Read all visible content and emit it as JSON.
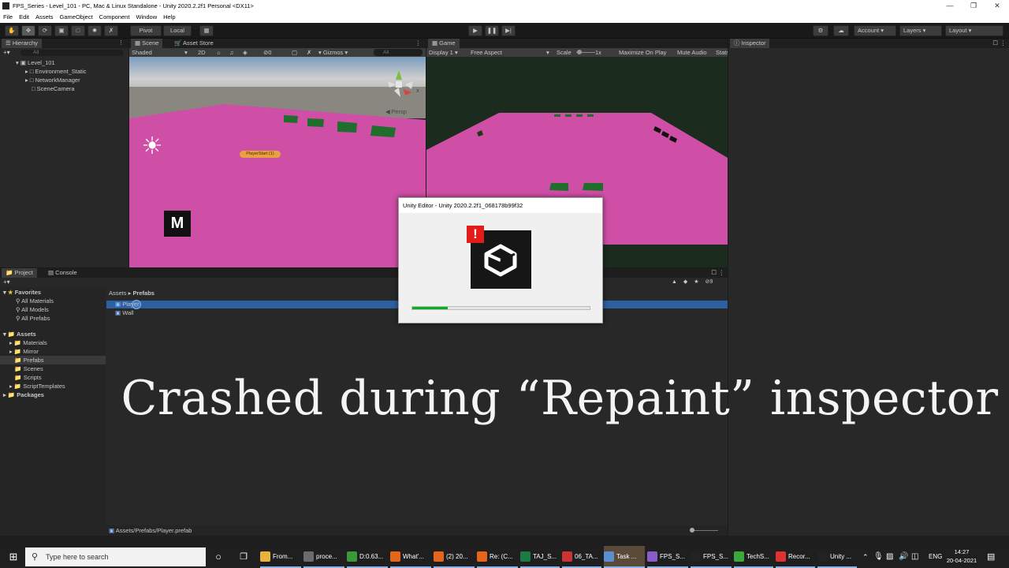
{
  "window": {
    "title": "FPS_Series - Level_101 - PC, Mac & Linux Standalone - Unity 2020.2.2f1 Personal <DX11>"
  },
  "menu": [
    "File",
    "Edit",
    "Assets",
    "GameObject",
    "Component",
    "Window",
    "Help"
  ],
  "toolbar": {
    "pivot": "Pivot",
    "local": "Local",
    "account": "Account",
    "layers": "Layers",
    "layout": "Layout"
  },
  "hierarchy": {
    "tab": "Hierarchy",
    "search_placeholder": "All",
    "root": "Level_101",
    "items": [
      "Environment_Static",
      "NetworkManager",
      "SceneCamera"
    ]
  },
  "scene": {
    "tab_scene": "Scene",
    "tab_asset_store": "Asset Store",
    "shading": "Shaded",
    "mode_2d": "2D",
    "fx_count": "0",
    "gizmos": "Gizmos",
    "search_placeholder": "All",
    "persp": "Persp",
    "player_start": "PlayerStart (1)",
    "overlay_glyph": "M"
  },
  "game": {
    "tab": "Game",
    "display": "Display 1",
    "aspect": "Free Aspect",
    "scale_label": "Scale",
    "scale_value": "1x",
    "maximize": "Maximize On Play",
    "mute": "Mute Audio",
    "stats": "Stats"
  },
  "inspector": {
    "tab": "Inspector"
  },
  "project": {
    "tab_project": "Project",
    "tab_console": "Console",
    "favorites": "Favorites",
    "favorites_items": [
      "All Materials",
      "All Models",
      "All Prefabs"
    ],
    "assets": "Assets",
    "asset_folders": [
      "Materials",
      "Mirror",
      "Prefabs",
      "Scenes",
      "Scripts",
      "ScriptTemplates"
    ],
    "packages": "Packages",
    "breadcrumb_root": "Assets",
    "breadcrumb_current": "Prefabs",
    "files": [
      "Player",
      "Wall"
    ],
    "status_path": "Assets/Prefabs/Player.prefab",
    "hidden_count": "9"
  },
  "dialog": {
    "title": "Unity Editor - Unity 2020.2.2f1_068178b99f32",
    "alert": "!",
    "progress": 0.2
  },
  "caption": "Crashed during “Repaint” inspector",
  "taskbar": {
    "search_placeholder": "Type here to search",
    "apps": [
      {
        "label": "From...",
        "color": "#e8b33c"
      },
      {
        "label": "proce...",
        "color": "#6c6c6c"
      },
      {
        "label": "D:0.63...",
        "color": "#3a9a3a"
      },
      {
        "label": "What'...",
        "color": "#e5661a"
      },
      {
        "label": "(2) 20...",
        "color": "#e5661a"
      },
      {
        "label": "Re: (C...",
        "color": "#e5661a"
      },
      {
        "label": "TAJ_S...",
        "color": "#1d7a44"
      },
      {
        "label": "06_TA...",
        "color": "#c33"
      },
      {
        "label": "Task ...",
        "color": "#5b8fd0"
      },
      {
        "label": "FPS_S...",
        "color": "#8a5cc7"
      },
      {
        "label": "FPS_S...",
        "color": "#222"
      },
      {
        "label": "TechS...",
        "color": "#3aa83a"
      },
      {
        "label": "Recor...",
        "color": "#d33"
      },
      {
        "label": "Unity ...",
        "color": "#222"
      }
    ],
    "lang": "ENG",
    "time": "14:27",
    "date": "20-04-2021"
  }
}
